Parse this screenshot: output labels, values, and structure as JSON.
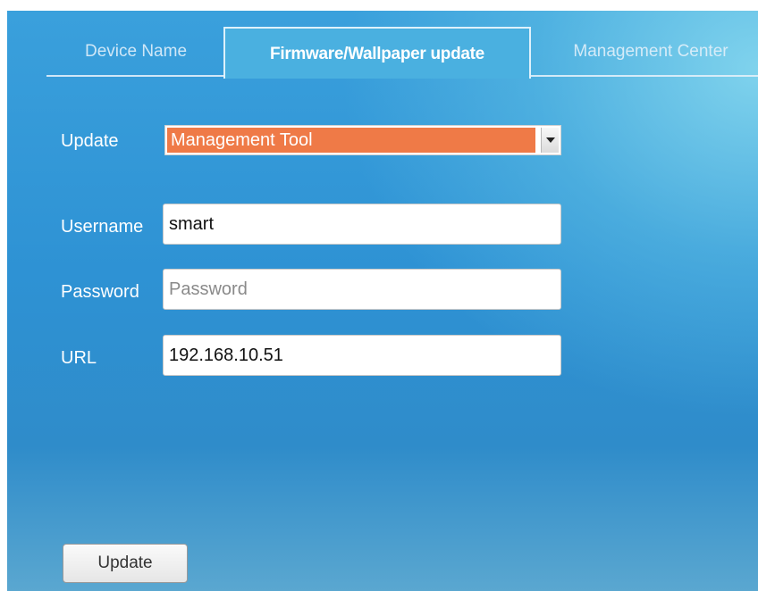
{
  "tabs": [
    {
      "label": "Device Name"
    },
    {
      "label": "Firmware/Wallpaper update"
    },
    {
      "label": "Management Center"
    }
  ],
  "form": {
    "update_label": "Update",
    "update_selected": "Management Tool",
    "username_label": "Username",
    "username_value": "smart",
    "password_label": "Password",
    "password_value": "",
    "password_placeholder": "Password",
    "url_label": "URL",
    "url_value": "192.168.10.51"
  },
  "actions": {
    "update_button_label": "Update"
  },
  "colors": {
    "selection_highlight": "#ef7a47",
    "background_blue": "#2e92d4"
  }
}
